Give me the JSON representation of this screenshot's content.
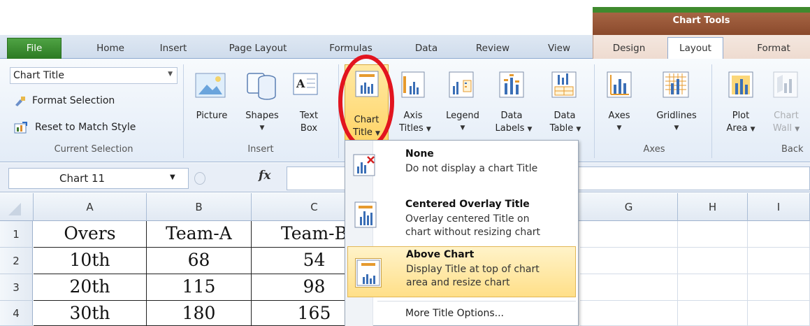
{
  "chart_tools": {
    "label": "Chart Tools"
  },
  "tabs": {
    "file": "File",
    "home": "Home",
    "insert": "Insert",
    "page_layout": "Page Layout",
    "formulas": "Formulas",
    "data": "Data",
    "review": "Review",
    "view": "View",
    "design": "Design",
    "layout": "Layout",
    "format": "Format"
  },
  "current_selection": {
    "dropdown_value": "Chart Title",
    "format_selection": "Format Selection",
    "reset_style": "Reset to Match Style",
    "group_label": "Current Selection"
  },
  "insert_group": {
    "picture": "Picture",
    "shapes": "Shapes",
    "text_box_1": "Text",
    "text_box_2": "Box",
    "group_label": "Insert"
  },
  "labels_group": {
    "chart_title_1": "Chart",
    "chart_title_2": "Title",
    "axis_titles_1": "Axis",
    "axis_titles_2": "Titles",
    "legend": "Legend",
    "data_labels_1": "Data",
    "data_labels_2": "Labels",
    "data_table_1": "Data",
    "data_table_2": "Table"
  },
  "axes_group": {
    "axes": "Axes",
    "gridlines": "Gridlines",
    "group_label": "Axes"
  },
  "background_group": {
    "plot_area_1": "Plot",
    "plot_area_2": "Area",
    "chart_wall_1": "Chart",
    "chart_wall_2": "Wall",
    "group_label": "Back"
  },
  "formula_bar": {
    "name_box": "Chart 11",
    "fx": "fx"
  },
  "columns": [
    "A",
    "B",
    "C",
    "G",
    "H",
    "I"
  ],
  "rows": [
    "1",
    "2",
    "3",
    "4"
  ],
  "sheet": {
    "header": [
      "Overs",
      "Team-A",
      "Team-B"
    ],
    "rows": [
      [
        "10th",
        "68",
        "54"
      ],
      [
        "20th",
        "115",
        "98"
      ],
      [
        "30th",
        "180",
        "165"
      ]
    ]
  },
  "menu": {
    "none_title": "None",
    "none_desc": "Do not display a chart Title",
    "overlay_title": "Centered Overlay Title",
    "overlay_desc_1": "Overlay centered Title on",
    "overlay_desc_2": "chart without resizing chart",
    "above_title": "Above Chart",
    "above_desc_1": "Display Title at top of chart",
    "above_desc_2": "area and resize chart",
    "more_options": "More Title Options..."
  }
}
